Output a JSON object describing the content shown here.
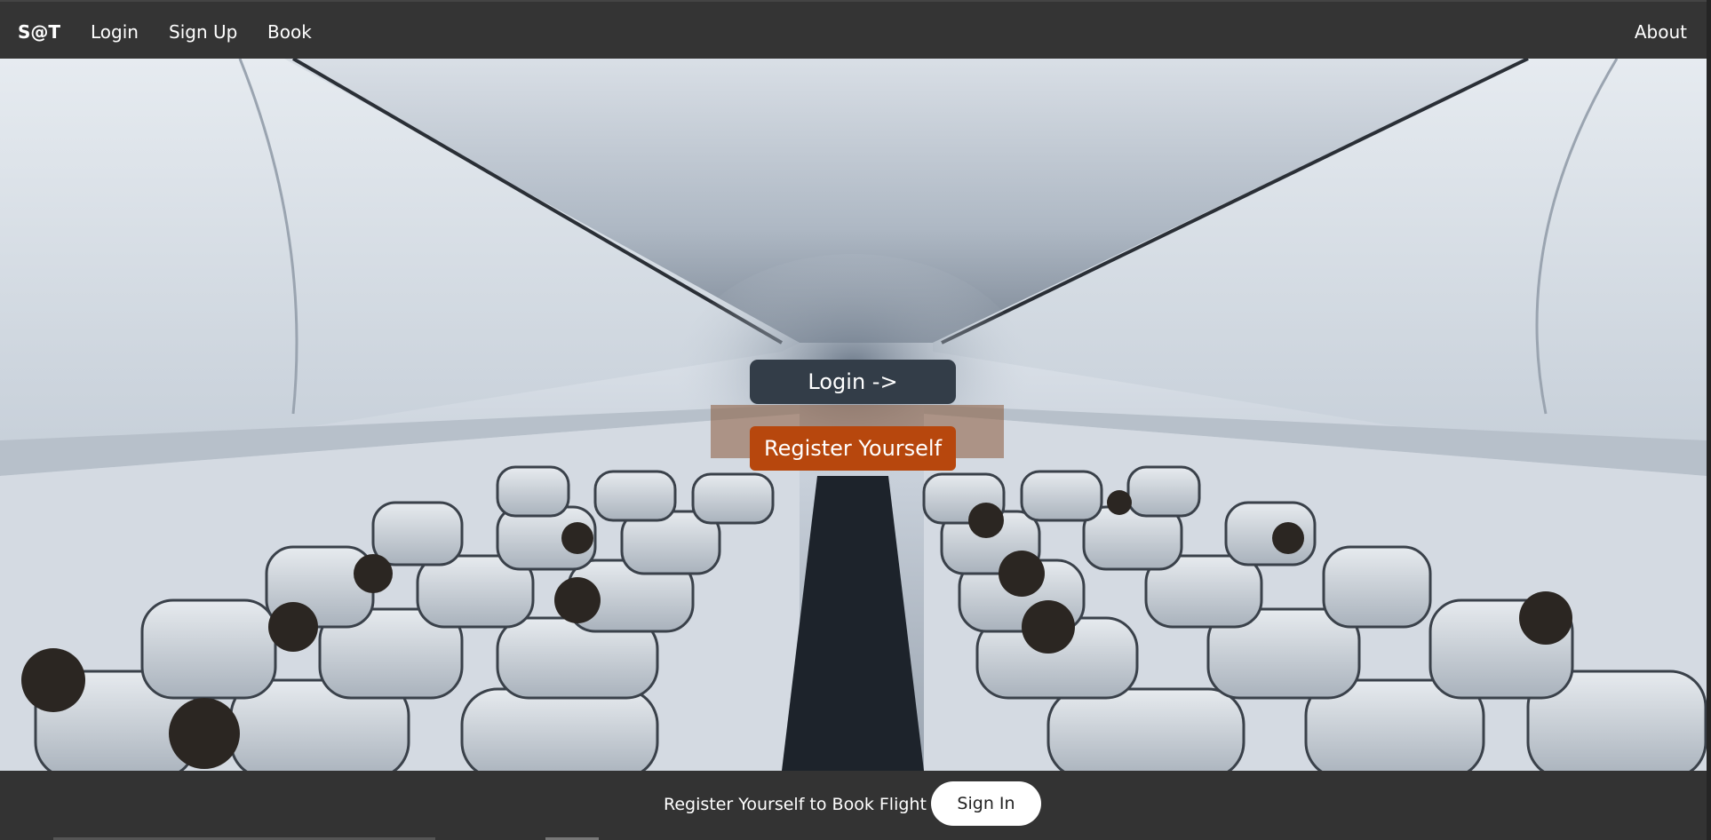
{
  "navbar": {
    "brand": "S@T",
    "links": {
      "login": "Login",
      "signup": "Sign Up",
      "book": "Book",
      "about": "About"
    }
  },
  "hero": {
    "image_subject": "airplane cabin interior with passengers seated",
    "login_button": "Login ->",
    "register_button": "Register Yourself"
  },
  "footer": {
    "text": "Register Yourself to Book Flight",
    "signin_button": "Sign In"
  },
  "colors": {
    "navbar_bg": "#343434",
    "login_button_bg": "#333d48",
    "register_button_bg": "#b7470d",
    "footer_bg": "#333333",
    "signin_button_bg": "#ffffff"
  }
}
